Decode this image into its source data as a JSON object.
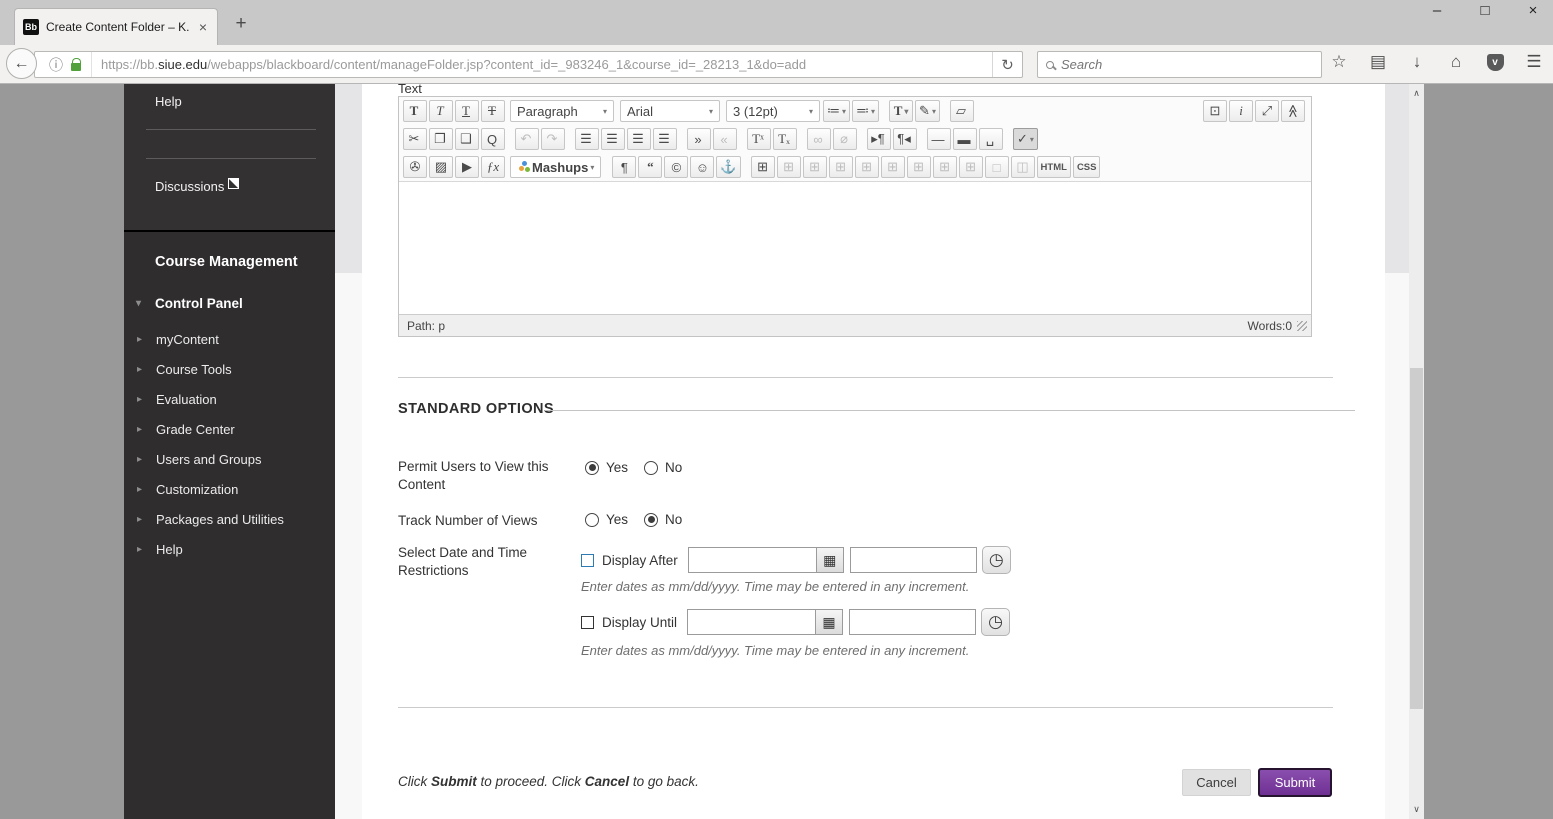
{
  "browser": {
    "window_controls": {
      "minimize": "–",
      "maximize": "□",
      "close": "×"
    },
    "tab": {
      "favicon_text": "Bb",
      "title": "Create Content Folder – K...",
      "close": "×",
      "new_tab": "+"
    },
    "nav": {
      "back": "←",
      "info": "ⓘ",
      "reload": "↻",
      "url_scheme": "https://bb.",
      "url_domain": "siue.edu",
      "url_path": "/webapps/blackboard/content/manageFolder.jsp?content_id=_983246_1&course_id=_28213_1&do=add",
      "search_placeholder": "Search",
      "icons": {
        "star": "☆",
        "pages": "▤",
        "download": "↓",
        "home": "⌂",
        "pocket": "v",
        "menu": "☰"
      }
    }
  },
  "sidebar": {
    "help_top": "Help",
    "discussions": "Discussions",
    "section_title": "Course Management",
    "control_panel": "Control Panel",
    "chevron_down": "▾",
    "chevron_right": "▸",
    "items": [
      {
        "n": "sidebar-item-mycontent",
        "label": "myContent"
      },
      {
        "n": "sidebar-item-course-tools",
        "label": "Course Tools"
      },
      {
        "n": "sidebar-item-evaluation",
        "label": "Evaluation"
      },
      {
        "n": "sidebar-item-grade-center",
        "label": "Grade Center"
      },
      {
        "n": "sidebar-item-users-and-groups",
        "label": "Users and Groups"
      },
      {
        "n": "sidebar-item-customization",
        "label": "Customization"
      },
      {
        "n": "sidebar-item-packages-and-utilities",
        "label": "Packages and Utilities"
      },
      {
        "n": "sidebar-item-help",
        "label": "Help"
      }
    ]
  },
  "editor": {
    "label": "Text",
    "caret": "▾",
    "paragraph": "Paragraph",
    "font": "Arial",
    "size": "3 (12pt)",
    "mashups": "Mashups",
    "path": "Path: p",
    "words": "Words:0",
    "row1": [
      {
        "n": "bold-icon",
        "g": "T",
        "c": "sf b"
      },
      {
        "n": "italic-icon",
        "g": "T",
        "c": "sf i"
      },
      {
        "n": "underline-icon",
        "g": "T",
        "c": "sf u"
      },
      {
        "n": "strikethrough-icon",
        "g": "T",
        "c": "sf s"
      }
    ],
    "row1b": [
      {
        "n": "bullet-list-icon",
        "g": "≔",
        "cr": "▾"
      },
      {
        "n": "numbered-list-icon",
        "g": "≕",
        "cr": "▾"
      },
      {
        "n": "text-color-icon",
        "g": "T",
        "c": "sf b gap",
        "cr": "▾"
      },
      {
        "n": "highlight-icon",
        "g": "✎",
        "cr": "▾"
      },
      {
        "n": "clear-format-icon",
        "g": "▱",
        "c": "gap"
      }
    ],
    "row1r": [
      {
        "n": "preview-icon",
        "g": "⊡"
      },
      {
        "n": "accessibility-icon",
        "g": "i",
        "c": "sf i"
      },
      {
        "n": "fullscreen-icon",
        "g": "⤢"
      },
      {
        "n": "collapse-toolbar-icon",
        "g": "≫",
        "c": "rot"
      }
    ],
    "row2": [
      {
        "n": "cut-icon",
        "g": "✂"
      },
      {
        "n": "copy-icon",
        "g": "❐"
      },
      {
        "n": "paste-icon",
        "g": "❑"
      },
      {
        "n": "find-icon",
        "g": "Q"
      },
      {
        "n": "undo-icon",
        "g": "↶",
        "c": "mut gap"
      },
      {
        "n": "redo-icon",
        "g": "↷",
        "c": "mut"
      },
      {
        "n": "align-left-icon",
        "g": "☰",
        "c": "gap"
      },
      {
        "n": "align-center-icon",
        "g": "☰"
      },
      {
        "n": "align-right-icon",
        "g": "☰"
      },
      {
        "n": "align-justify-icon",
        "g": "☰"
      },
      {
        "n": "indent-icon",
        "g": "»",
        "c": "gap"
      },
      {
        "n": "outdent-icon",
        "g": "«",
        "c": "mut"
      },
      {
        "n": "superscript-icon",
        "g": "Tˣ",
        "c": "sf gap"
      },
      {
        "n": "subscript-icon",
        "g": "Tₓ",
        "c": "sf"
      },
      {
        "n": "link-icon",
        "g": "∞",
        "c": "mut gap"
      },
      {
        "n": "unlink-icon",
        "g": "⌀",
        "c": "mut"
      },
      {
        "n": "rtl-icon",
        "g": "▸¶",
        "c": "gap"
      },
      {
        "n": "ltr-icon",
        "g": "¶◂"
      },
      {
        "n": "hr-icon",
        "g": "—",
        "c": "gap"
      },
      {
        "n": "thick-hr-icon",
        "g": "▬"
      },
      {
        "n": "nbsp-icon",
        "g": "␣"
      },
      {
        "n": "spellcheck-icon",
        "g": "✓",
        "c": "act gap",
        "cr": "▾"
      }
    ],
    "row3a": [
      {
        "n": "attach-file-icon",
        "g": "✇"
      },
      {
        "n": "insert-image-icon",
        "g": "▨"
      },
      {
        "n": "insert-video-icon",
        "g": "▶"
      },
      {
        "n": "math-editor-icon",
        "g": "ƒx",
        "c": "sf i"
      }
    ],
    "row3b": [
      {
        "n": "paragraph-mark-icon",
        "g": "¶",
        "c": "gap"
      },
      {
        "n": "blockquote-icon",
        "g": "“",
        "c": "sf b"
      },
      {
        "n": "symbol-icon",
        "g": "©"
      },
      {
        "n": "emoticon-icon",
        "g": "☺"
      },
      {
        "n": "anchor-icon",
        "g": "⚓"
      },
      {
        "n": "insert-table-icon",
        "g": "⊞",
        "c": "gap"
      },
      {
        "n": "row-properties-icon",
        "g": "⊞",
        "c": "mut"
      },
      {
        "n": "cell-properties-icon",
        "g": "⊞",
        "c": "mut"
      },
      {
        "n": "insert-row-above-icon",
        "g": "⊞",
        "c": "mut"
      },
      {
        "n": "insert-row-below-icon",
        "g": "⊞",
        "c": "mut"
      },
      {
        "n": "delete-row-icon",
        "g": "⊞",
        "c": "mut"
      },
      {
        "n": "insert-column-left-icon",
        "g": "⊞",
        "c": "mut"
      },
      {
        "n": "insert-column-right-icon",
        "g": "⊞",
        "c": "mut"
      },
      {
        "n": "delete-column-icon",
        "g": "⊞",
        "c": "mut"
      },
      {
        "n": "merge-cells-icon",
        "g": "□",
        "c": "mut"
      },
      {
        "n": "split-cells-icon",
        "g": "◫",
        "c": "mut"
      },
      {
        "n": "html-source-button",
        "g": "HTML",
        "c": "txt"
      },
      {
        "n": "css-button",
        "g": "CSS",
        "c": "txt"
      }
    ]
  },
  "form": {
    "heading": "STANDARD OPTIONS",
    "permit": {
      "label": "Permit Users to View this Content",
      "yes": "Yes",
      "no": "No"
    },
    "track": {
      "label": "Track Number of Views",
      "yes": "Yes",
      "no": "No"
    },
    "dates": {
      "label": "Select Date and Time Restrictions",
      "after_label": "Display After",
      "until_label": "Display Until",
      "hint": "Enter dates as mm/dd/yyyy. Time may be entered in any increment.",
      "calendar_glyph": "▦",
      "clock_glyph": "◷"
    }
  },
  "footer": {
    "p1": "Click ",
    "b1": "Submit",
    "p2": " to proceed. Click ",
    "b2": "Cancel",
    "p3": " to go back.",
    "cancel": "Cancel",
    "submit": "Submit"
  },
  "scrollbar": {
    "up": "∧",
    "down": "∨"
  }
}
